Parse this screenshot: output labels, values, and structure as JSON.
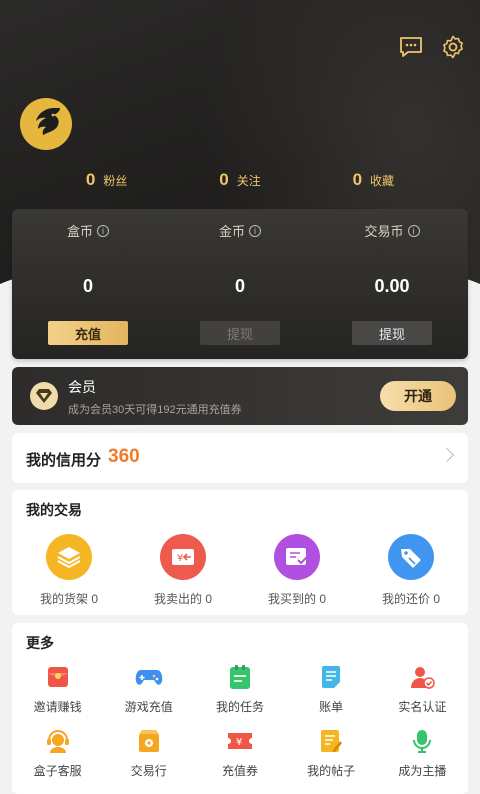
{
  "colors": {
    "accent_gold": "#f0c56a",
    "credit_orange": "#f27b2a",
    "dark_bg": "#1f1e1d"
  },
  "header": {
    "icons": [
      "message-icon",
      "settings-icon"
    ]
  },
  "profile": {
    "avatar": "golden-dragon-avatar"
  },
  "stats": [
    {
      "value": "0",
      "label": "粉丝"
    },
    {
      "value": "0",
      "label": "关注"
    },
    {
      "value": "0",
      "label": "收藏"
    }
  ],
  "wallet": [
    {
      "title": "盒币",
      "value": "0",
      "button": "充值"
    },
    {
      "title": "金币",
      "value": "0",
      "button": "提现"
    },
    {
      "title": "交易币",
      "value": "0.00",
      "button": "提现"
    }
  ],
  "vip": {
    "name": "会员",
    "desc": "成为会员30天可得192元通用充值券",
    "button": "开通"
  },
  "credit": {
    "label": "我的信用分",
    "score": "360"
  },
  "trade": {
    "title": "我的交易",
    "items": [
      {
        "label": "我的货架 0",
        "icon": "shelf-icon",
        "color": "#f5b623"
      },
      {
        "label": "我卖出的 0",
        "icon": "sold-icon",
        "color": "#ee5a4c"
      },
      {
        "label": "我买到的 0",
        "icon": "bought-icon",
        "color": "#b04fe0"
      },
      {
        "label": "我的还价 0",
        "icon": "bargain-icon",
        "color": "#3f95f0"
      }
    ]
  },
  "more": {
    "title": "更多",
    "items": [
      {
        "label": "邀请赚钱",
        "icon": "red-envelope-icon"
      },
      {
        "label": "游戏充值",
        "icon": "gamepad-icon"
      },
      {
        "label": "我的任务",
        "icon": "task-icon"
      },
      {
        "label": "账单",
        "icon": "bill-icon"
      },
      {
        "label": "实名认证",
        "icon": "id-verify-icon"
      },
      {
        "label": "盒子客服",
        "icon": "customer-service-icon"
      },
      {
        "label": "交易行",
        "icon": "trade-house-icon"
      },
      {
        "label": "充值券",
        "icon": "coupon-icon"
      },
      {
        "label": "我的帖子",
        "icon": "post-icon"
      },
      {
        "label": "成为主播",
        "icon": "microphone-icon"
      }
    ]
  }
}
